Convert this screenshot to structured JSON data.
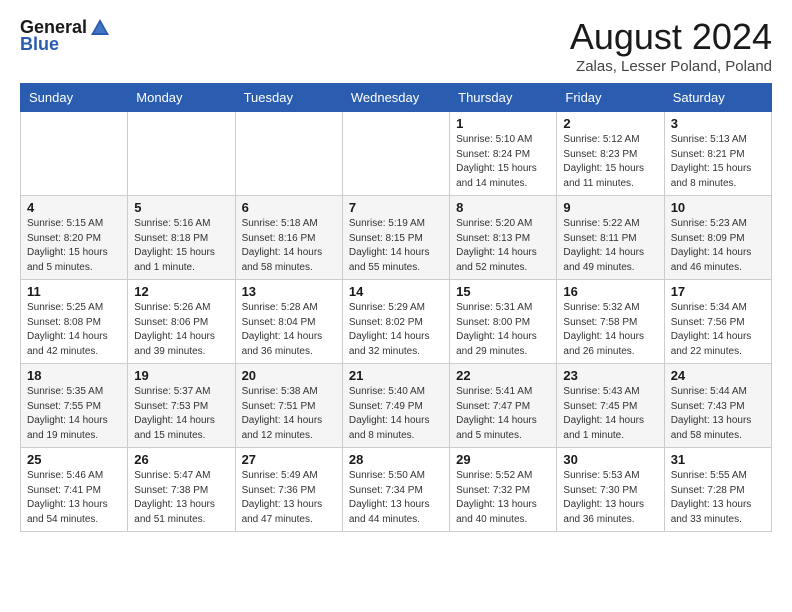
{
  "header": {
    "logo_general": "General",
    "logo_blue": "Blue",
    "title": "August 2024",
    "subtitle": "Zalas, Lesser Poland, Poland"
  },
  "days_of_week": [
    "Sunday",
    "Monday",
    "Tuesday",
    "Wednesday",
    "Thursday",
    "Friday",
    "Saturday"
  ],
  "weeks": [
    [
      {
        "day": "",
        "info": ""
      },
      {
        "day": "",
        "info": ""
      },
      {
        "day": "",
        "info": ""
      },
      {
        "day": "",
        "info": ""
      },
      {
        "day": "1",
        "info": "Sunrise: 5:10 AM\nSunset: 8:24 PM\nDaylight: 15 hours and 14 minutes."
      },
      {
        "day": "2",
        "info": "Sunrise: 5:12 AM\nSunset: 8:23 PM\nDaylight: 15 hours and 11 minutes."
      },
      {
        "day": "3",
        "info": "Sunrise: 5:13 AM\nSunset: 8:21 PM\nDaylight: 15 hours and 8 minutes."
      }
    ],
    [
      {
        "day": "4",
        "info": "Sunrise: 5:15 AM\nSunset: 8:20 PM\nDaylight: 15 hours and 5 minutes."
      },
      {
        "day": "5",
        "info": "Sunrise: 5:16 AM\nSunset: 8:18 PM\nDaylight: 15 hours and 1 minute."
      },
      {
        "day": "6",
        "info": "Sunrise: 5:18 AM\nSunset: 8:16 PM\nDaylight: 14 hours and 58 minutes."
      },
      {
        "day": "7",
        "info": "Sunrise: 5:19 AM\nSunset: 8:15 PM\nDaylight: 14 hours and 55 minutes."
      },
      {
        "day": "8",
        "info": "Sunrise: 5:20 AM\nSunset: 8:13 PM\nDaylight: 14 hours and 52 minutes."
      },
      {
        "day": "9",
        "info": "Sunrise: 5:22 AM\nSunset: 8:11 PM\nDaylight: 14 hours and 49 minutes."
      },
      {
        "day": "10",
        "info": "Sunrise: 5:23 AM\nSunset: 8:09 PM\nDaylight: 14 hours and 46 minutes."
      }
    ],
    [
      {
        "day": "11",
        "info": "Sunrise: 5:25 AM\nSunset: 8:08 PM\nDaylight: 14 hours and 42 minutes."
      },
      {
        "day": "12",
        "info": "Sunrise: 5:26 AM\nSunset: 8:06 PM\nDaylight: 14 hours and 39 minutes."
      },
      {
        "day": "13",
        "info": "Sunrise: 5:28 AM\nSunset: 8:04 PM\nDaylight: 14 hours and 36 minutes."
      },
      {
        "day": "14",
        "info": "Sunrise: 5:29 AM\nSunset: 8:02 PM\nDaylight: 14 hours and 32 minutes."
      },
      {
        "day": "15",
        "info": "Sunrise: 5:31 AM\nSunset: 8:00 PM\nDaylight: 14 hours and 29 minutes."
      },
      {
        "day": "16",
        "info": "Sunrise: 5:32 AM\nSunset: 7:58 PM\nDaylight: 14 hours and 26 minutes."
      },
      {
        "day": "17",
        "info": "Sunrise: 5:34 AM\nSunset: 7:56 PM\nDaylight: 14 hours and 22 minutes."
      }
    ],
    [
      {
        "day": "18",
        "info": "Sunrise: 5:35 AM\nSunset: 7:55 PM\nDaylight: 14 hours and 19 minutes."
      },
      {
        "day": "19",
        "info": "Sunrise: 5:37 AM\nSunset: 7:53 PM\nDaylight: 14 hours and 15 minutes."
      },
      {
        "day": "20",
        "info": "Sunrise: 5:38 AM\nSunset: 7:51 PM\nDaylight: 14 hours and 12 minutes."
      },
      {
        "day": "21",
        "info": "Sunrise: 5:40 AM\nSunset: 7:49 PM\nDaylight: 14 hours and 8 minutes."
      },
      {
        "day": "22",
        "info": "Sunrise: 5:41 AM\nSunset: 7:47 PM\nDaylight: 14 hours and 5 minutes."
      },
      {
        "day": "23",
        "info": "Sunrise: 5:43 AM\nSunset: 7:45 PM\nDaylight: 14 hours and 1 minute."
      },
      {
        "day": "24",
        "info": "Sunrise: 5:44 AM\nSunset: 7:43 PM\nDaylight: 13 hours and 58 minutes."
      }
    ],
    [
      {
        "day": "25",
        "info": "Sunrise: 5:46 AM\nSunset: 7:41 PM\nDaylight: 13 hours and 54 minutes."
      },
      {
        "day": "26",
        "info": "Sunrise: 5:47 AM\nSunset: 7:38 PM\nDaylight: 13 hours and 51 minutes."
      },
      {
        "day": "27",
        "info": "Sunrise: 5:49 AM\nSunset: 7:36 PM\nDaylight: 13 hours and 47 minutes."
      },
      {
        "day": "28",
        "info": "Sunrise: 5:50 AM\nSunset: 7:34 PM\nDaylight: 13 hours and 44 minutes."
      },
      {
        "day": "29",
        "info": "Sunrise: 5:52 AM\nSunset: 7:32 PM\nDaylight: 13 hours and 40 minutes."
      },
      {
        "day": "30",
        "info": "Sunrise: 5:53 AM\nSunset: 7:30 PM\nDaylight: 13 hours and 36 minutes."
      },
      {
        "day": "31",
        "info": "Sunrise: 5:55 AM\nSunset: 7:28 PM\nDaylight: 13 hours and 33 minutes."
      }
    ]
  ]
}
